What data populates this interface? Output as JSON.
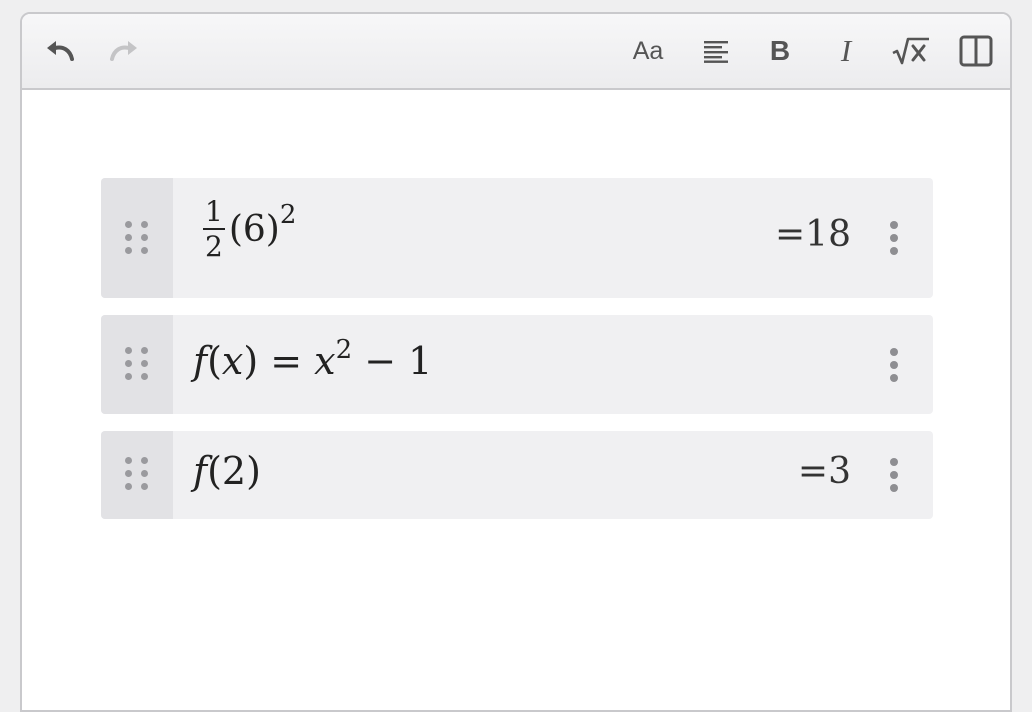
{
  "toolbar": {
    "undo_icon": "undo-icon",
    "redo_icon": "redo-icon",
    "font_size_label": "Aa",
    "align_icon": "align-left-icon",
    "bold_label": "B",
    "italic_label": "I",
    "math_icon": "sqrt-x-icon",
    "split_icon": "split-view-icon"
  },
  "rows": [
    {
      "fraction_numerator": "1",
      "fraction_denominator": "2",
      "expression_rest": "(6)",
      "exponent": "2",
      "result": "=18"
    },
    {
      "fn": "f",
      "open": "(",
      "arg": "x",
      "close": ")",
      "equals": " = ",
      "base": "x",
      "exponent": "2",
      "tail": " − 1",
      "result": ""
    },
    {
      "fn": "f",
      "open": "(",
      "arg": "2",
      "close": ")",
      "result": "=3"
    }
  ],
  "colors": {
    "row_background": "#f0f0f2",
    "handle_background": "#e2e2e5",
    "toolbar_icon": "#555555"
  }
}
